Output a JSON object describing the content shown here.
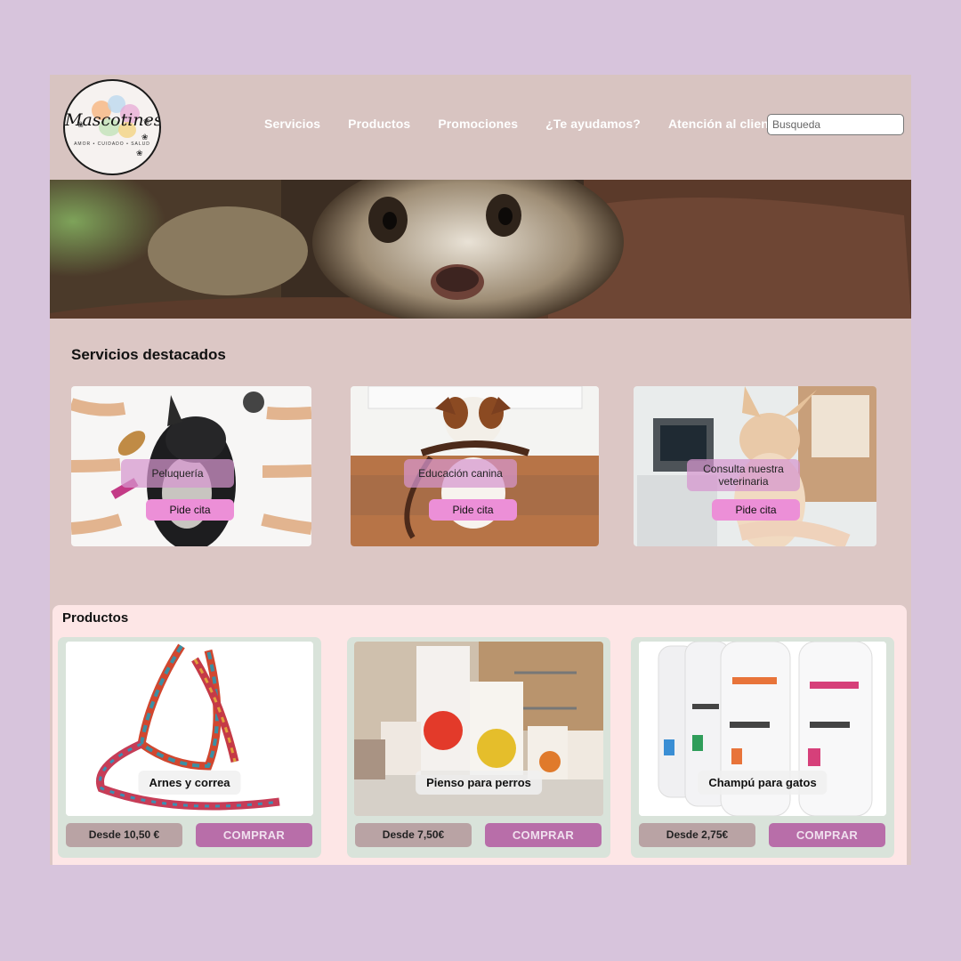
{
  "brand": {
    "logo_text": "Mascotines",
    "logo_sub": "AMOR • CUIDADO • SALUD"
  },
  "nav": {
    "items": [
      "Servicios",
      "Productos",
      "Promociones",
      "¿Te ayudamos?",
      "Atención al cliente"
    ]
  },
  "search": {
    "placeholder": "Busqueda"
  },
  "hero": {
    "image": "ferret-photo"
  },
  "services": {
    "title": "Servicios destacados",
    "items": [
      {
        "label": "Peluquería",
        "button": "Pide cita",
        "image": "dog-grooming-photo"
      },
      {
        "label": "Educación canina",
        "button": "Pide cita",
        "image": "dog-with-leash-photo"
      },
      {
        "label": "Consulta nuestra veterinaria",
        "button": "Pide cita",
        "image": "chihuahua-vet-photo"
      }
    ]
  },
  "products": {
    "title": "Productos",
    "items": [
      {
        "name": "Arnes y correa",
        "price": "Desde 10,50 €",
        "button": "COMPRAR",
        "image": "harness-leash-photo"
      },
      {
        "name": "Pienso para perros",
        "price": "Desde 7,50€",
        "button": "COMPRAR",
        "image": "dog-food-bags-photo"
      },
      {
        "name": "Champú para gatos",
        "price": "Desde 2,75€",
        "button": "COMPRAR",
        "image": "shampoo-bottles-photo"
      }
    ]
  },
  "colors": {
    "background": "#d7c4dc",
    "header": "#d8c4c1",
    "pide_cita": "#ec8fd7",
    "comprar": "#b86ea9",
    "products_bg": "#fde6e6"
  }
}
